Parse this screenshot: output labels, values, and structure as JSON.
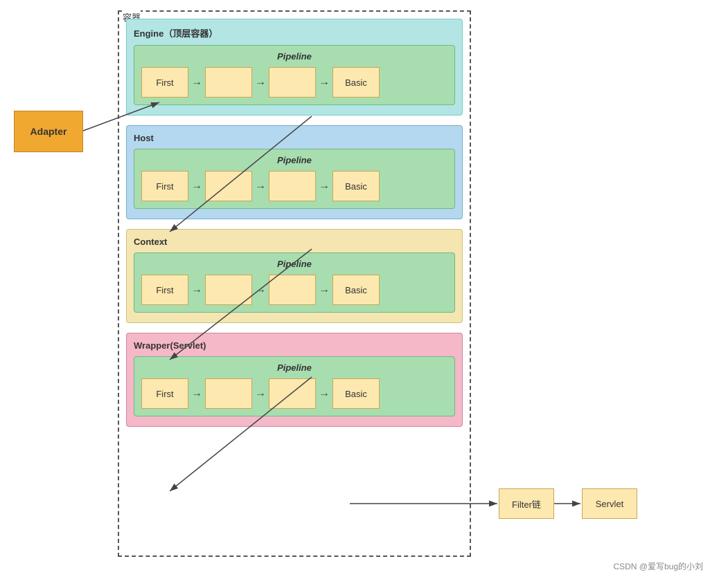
{
  "container_label": "容器",
  "adapter": {
    "label": "Adapter"
  },
  "engine": {
    "label": "Engine（顶层容器）",
    "pipeline_label": "Pipeline",
    "boxes": [
      "First",
      "",
      "",
      "Basic"
    ]
  },
  "host": {
    "label": "Host",
    "pipeline_label": "Pipeline",
    "boxes": [
      "First",
      "",
      "",
      "Basic"
    ]
  },
  "context": {
    "label": "Context",
    "pipeline_label": "Pipeline",
    "boxes": [
      "First",
      "",
      "",
      "Basic"
    ]
  },
  "wrapper": {
    "label": "Wrapper(Servlet)",
    "pipeline_label": "Pipeline",
    "boxes": [
      "First",
      "",
      "",
      "Basic"
    ]
  },
  "filter_chain": {
    "label": "Filter链"
  },
  "servlet": {
    "label": "Servlet"
  },
  "watermark": "CSDN @爱写bug的小刘"
}
